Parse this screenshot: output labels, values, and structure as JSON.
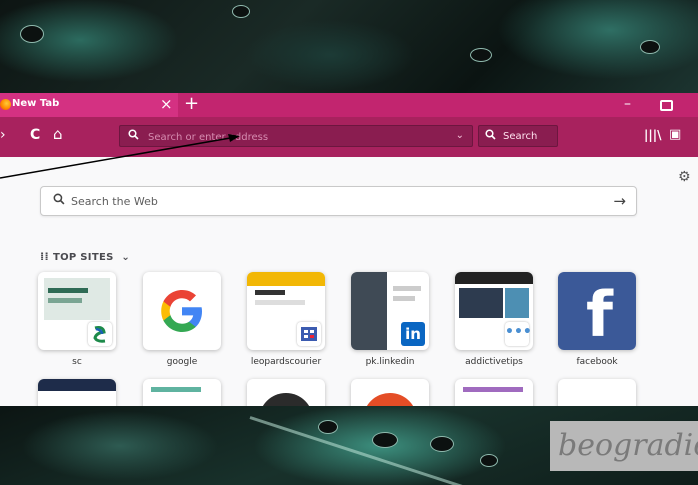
{
  "tab": {
    "title": "New Tab",
    "close": "×",
    "new_tab": "+"
  },
  "window": {
    "minimize": "–"
  },
  "toolbar": {
    "url_placeholder": "Search or enter address",
    "url_dropdown": "⌄",
    "search_label": "Search"
  },
  "content": {
    "web_search_label": "Search the Web",
    "web_search_go": "→",
    "top_sites_title": "TOP SITES",
    "top_sites_caret": "⌄",
    "top_sites": [
      {
        "label": "sc"
      },
      {
        "label": "google"
      },
      {
        "label": "leopardscourier"
      },
      {
        "label": "pk.linkedin"
      },
      {
        "label": "addictivetips"
      },
      {
        "label": "facebook"
      }
    ]
  },
  "icons": {
    "reload": "C",
    "home": "⌂",
    "library": "|||\\",
    "sidebar": "▣",
    "gear": "⚙",
    "search": "🔍"
  },
  "colors": {
    "tab_strip": "#c2256f",
    "toolbar": "#a8225e",
    "content_bg": "#f9f9fa"
  },
  "watermark": "beogradio"
}
